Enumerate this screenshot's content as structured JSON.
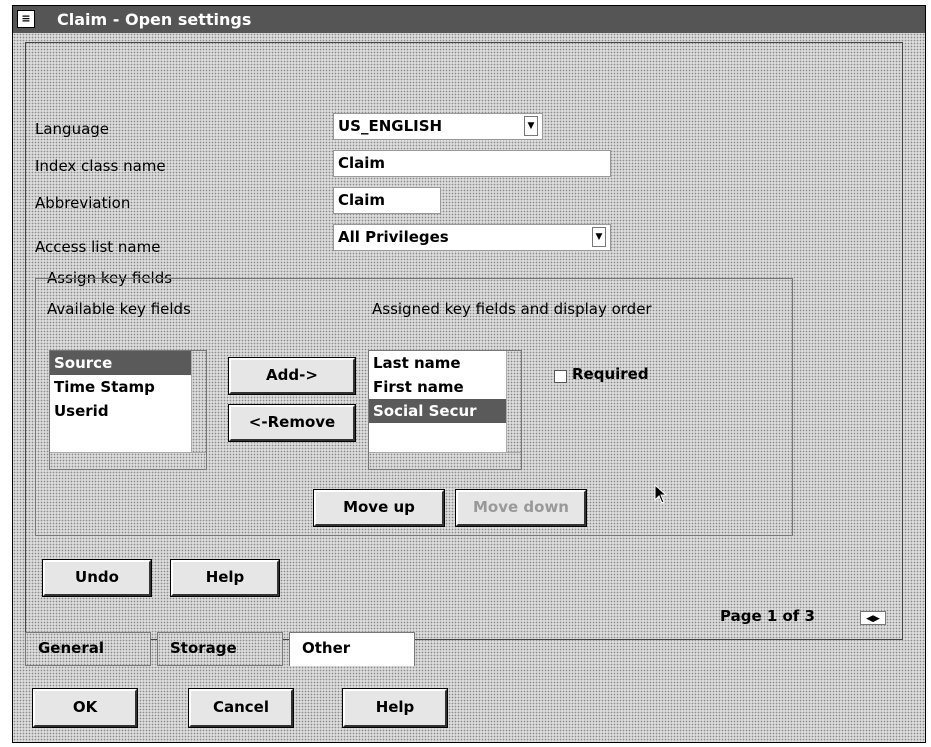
{
  "window": {
    "title": "Claim - Open settings"
  },
  "form": {
    "language": {
      "label": "Language",
      "value": "US_ENGLISH"
    },
    "index_class": {
      "label": "Index class name",
      "value": "Claim"
    },
    "abbreviation": {
      "label": "Abbreviation",
      "value": "Claim"
    },
    "access_list": {
      "label": "Access list name",
      "value": "All Privileges"
    }
  },
  "keyfields": {
    "group_label": "Assign key fields",
    "available_label": "Available key fields",
    "assigned_label": "Assigned key fields and display order",
    "available": [
      {
        "label": "Source",
        "selected": true
      },
      {
        "label": "Time Stamp",
        "selected": false
      },
      {
        "label": "Userid",
        "selected": false
      }
    ],
    "assigned": [
      {
        "label": "Last name",
        "selected": false
      },
      {
        "label": "First name",
        "selected": false
      },
      {
        "label": "Social Secur",
        "selected": true
      }
    ],
    "add_label": "Add->",
    "remove_label": "<-Remove",
    "required_label": "Required",
    "move_up_label": "Move up",
    "move_down_label": "Move down"
  },
  "page_buttons": {
    "undo": "Undo",
    "help": "Help"
  },
  "page_indicator": "Page 1 of 3",
  "tabs": [
    {
      "label": "General",
      "active": false
    },
    {
      "label": "Storage",
      "active": false
    },
    {
      "label": "Other",
      "active": true
    }
  ],
  "dialog_buttons": {
    "ok": "OK",
    "cancel": "Cancel",
    "help": "Help"
  },
  "colors": {
    "titlebar": "#555555",
    "selection": "#5a5a5a",
    "background_pattern": "#dcdcdc"
  }
}
